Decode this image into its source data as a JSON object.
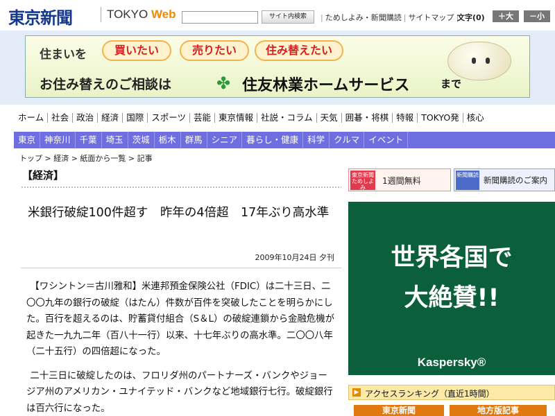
{
  "header": {
    "logo_ja": "東京新聞",
    "logo_en_main": "TOKYO ",
    "logo_en_accent": "Web",
    "search_placeholder": "",
    "search_button": "サイト内検索",
    "util_links": [
      "ためしよみ・新聞購読",
      "サイトマップ"
    ],
    "font_size_label": "文字(0)",
    "font_up": "＋大",
    "font_down": "－小"
  },
  "banner": {
    "line1_prefix": "住まいを",
    "bubbles": [
      "買いたい",
      "売りたい",
      "住み替えたい"
    ],
    "line2": "お住み替えのご相談は",
    "brand": "住友林業ホームサービス",
    "suffix": "まで",
    "brand_icon": "leaf-icon"
  },
  "nav_primary": [
    "ホーム",
    "社会",
    "政治",
    "経済",
    "国際",
    "スポーツ",
    "芸能",
    "東京情報",
    "社説・コラム",
    "天気",
    "囲碁・将棋",
    "特報",
    "TOKYO発",
    "核心"
  ],
  "nav_regional": [
    "東京",
    "神奈川",
    "千葉",
    "埼玉",
    "茨城",
    "栃木",
    "群馬",
    "シニア",
    "暮らし・健康",
    "科学",
    "クルマ",
    "イベント"
  ],
  "breadcrumb": "トップ > 経済 > 紙面から一覧 > 記事",
  "article": {
    "section": "【経済】",
    "title": "米銀行破綻100件超す　昨年の4倍超　17年ぶり高水準",
    "date": "2009年10月24日 夕刊",
    "paragraphs": [
      "【ワシントン＝古川雅和】米連邦預金保険公社（FDIC）は二十三日、二〇〇九年の銀行の破綻（はたん）件数が百件を突破したことを明らかにした。百行を超えるのは、貯蓄貸付組合（S＆L）の破綻連鎖から金融危機が起きた一九九二年（百八十一行）以来、十七年ぶりの高水準。二〇〇八年（二十五行）の四倍超になった。",
      "二十三日に破綻したのは、フロリダ州のパートナーズ・バンクやジョージア州のアメリカン・ユナイテッド・バンクなど地域銀行七行。破綻銀行は百六行になった。"
    ]
  },
  "sidebar": {
    "promo_trial_badge": "東京新聞 ためしよみ",
    "promo_trial": "1週間無料",
    "promo_subscribe_badge": "新聞購読",
    "promo_subscribe": "新聞購読のご案内",
    "ad_line1": "世界各国で",
    "ad_line2": "大絶賛!!",
    "ad_brand": "Kaspersky®",
    "ranking_title": "アクセスランキング（直近1時間）",
    "ranking_tabs": [
      "東京新聞",
      "地方版記事"
    ]
  },
  "colors": {
    "logo": "#14388c",
    "nav_regional_bg": "#6e6ee0",
    "ad_bg": "#0b5f3a",
    "ranking_tab": "#e07a10"
  }
}
